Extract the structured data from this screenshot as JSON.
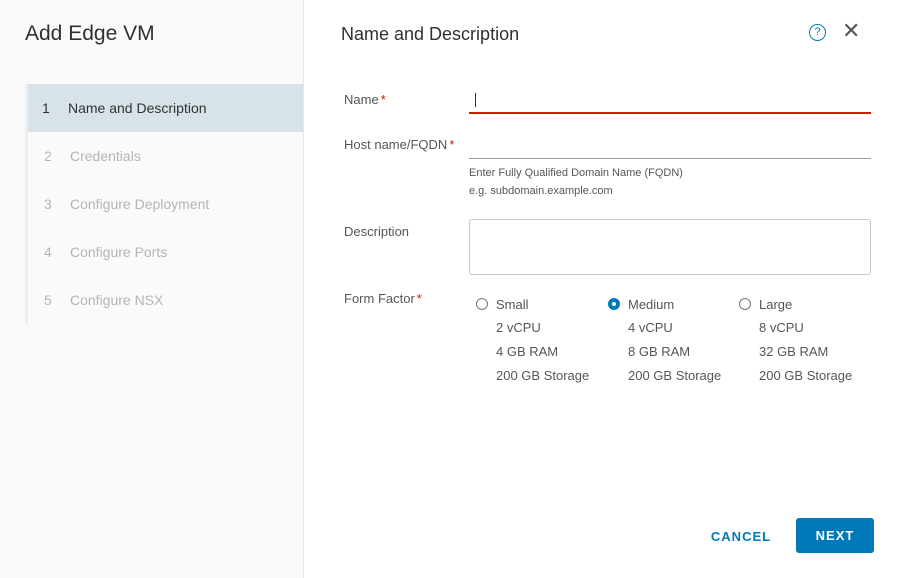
{
  "wizard": {
    "title": "Add Edge VM",
    "steps": [
      {
        "number": "1",
        "label": "Name and Description",
        "active": true
      },
      {
        "number": "2",
        "label": "Credentials",
        "active": false
      },
      {
        "number": "3",
        "label": "Configure Deployment",
        "active": false
      },
      {
        "number": "4",
        "label": "Configure Ports",
        "active": false
      },
      {
        "number": "5",
        "label": "Configure NSX",
        "active": false
      }
    ]
  },
  "page": {
    "title": "Name and Description",
    "help_icon": "help-circle-icon",
    "close_icon": "close-icon"
  },
  "form": {
    "name": {
      "label": "Name",
      "required_mark": "*",
      "value": ""
    },
    "hostname": {
      "label": "Host name/FQDN",
      "required_mark": "*",
      "value": "",
      "helper_line1": "Enter Fully Qualified Domain Name (FQDN)",
      "helper_line2": "e.g. subdomain.example.com"
    },
    "description": {
      "label": "Description",
      "value": ""
    },
    "form_factor": {
      "label": "Form Factor",
      "required_mark": "*",
      "selected": "Medium",
      "options": [
        {
          "label": "Small",
          "cpu": "2 vCPU",
          "ram": "4 GB RAM",
          "storage": "200 GB Storage"
        },
        {
          "label": "Medium",
          "cpu": "4 vCPU",
          "ram": "8 GB RAM",
          "storage": "200 GB Storage"
        },
        {
          "label": "Large",
          "cpu": "8 vCPU",
          "ram": "32 GB RAM",
          "storage": "200 GB Storage"
        }
      ]
    }
  },
  "footer": {
    "cancel_label": "CANCEL",
    "next_label": "NEXT"
  },
  "colors": {
    "accent": "#0079b8",
    "error": "#c92100",
    "active_step_bg": "#d8e3e9"
  }
}
